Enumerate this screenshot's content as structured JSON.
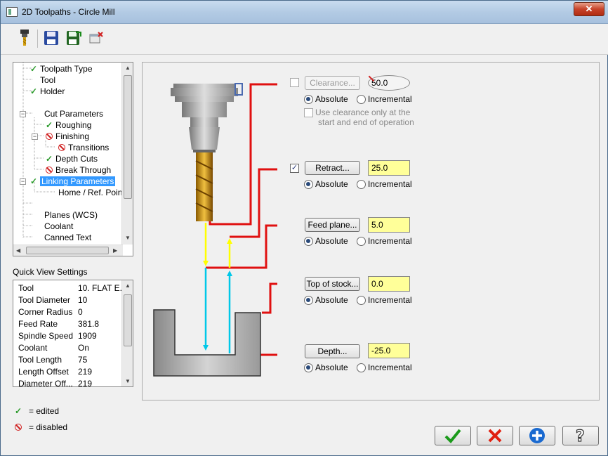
{
  "window": {
    "title": "2D Toolpaths - Circle Mill",
    "close_label": "✕"
  },
  "tree": {
    "items": [
      {
        "label": "Toolpath Type",
        "status": "edited"
      },
      {
        "label": "Tool",
        "status": ""
      },
      {
        "label": "Holder",
        "status": "edited"
      },
      {
        "label": "Cut Parameters",
        "status": ""
      },
      {
        "label": "Roughing",
        "status": "edited"
      },
      {
        "label": "Finishing",
        "status": "disabled"
      },
      {
        "label": "Transitions",
        "status": "disabled"
      },
      {
        "label": "Depth Cuts",
        "status": "edited"
      },
      {
        "label": "Break Through",
        "status": "disabled"
      },
      {
        "label": "Linking Parameters",
        "status": "edited"
      },
      {
        "label": "Home / Ref. Points",
        "status": ""
      },
      {
        "label": "Planes (WCS)",
        "status": ""
      },
      {
        "label": "Coolant",
        "status": ""
      },
      {
        "label": "Canned Text",
        "status": ""
      }
    ]
  },
  "quick_view": {
    "title": "Quick View Settings",
    "rows": [
      {
        "k": "Tool",
        "v": "10. FLAT E..."
      },
      {
        "k": "Tool Diameter",
        "v": "10"
      },
      {
        "k": "Corner Radius",
        "v": "0"
      },
      {
        "k": "Feed Rate",
        "v": "381.8"
      },
      {
        "k": "Spindle Speed",
        "v": "1909"
      },
      {
        "k": "Coolant",
        "v": "On"
      },
      {
        "k": "Tool Length",
        "v": "75"
      },
      {
        "k": "Length Offset",
        "v": "219"
      },
      {
        "k": "Diameter Off...",
        "v": "219"
      }
    ]
  },
  "legend": {
    "edited": "= edited",
    "disabled": "= disabled"
  },
  "params": {
    "clearance": {
      "label": "Clearance...",
      "value": "50.0",
      "absolute": "Absolute",
      "incremental": "Incremental",
      "note_line1": "Use clearance only at the",
      "note_line2": "start and end of operation"
    },
    "retract": {
      "label": "Retract...",
      "value": "25.0",
      "absolute": "Absolute",
      "incremental": "Incremental"
    },
    "feed_plane": {
      "label": "Feed plane...",
      "value": "5.0",
      "absolute": "Absolute",
      "incremental": "Incremental"
    },
    "top_of_stock": {
      "label": "Top of stock...",
      "value": "0.0",
      "absolute": "Absolute",
      "incremental": "Incremental"
    },
    "depth": {
      "label": "Depth...",
      "value": "-25.0",
      "absolute": "Absolute",
      "incremental": "Incremental"
    }
  },
  "colors": {
    "accent_red": "#e01010",
    "arrow_yellow": "#ffff00",
    "arrow_cyan": "#00c8e8",
    "field_yellow": "#ffff99",
    "selection_blue": "#3399ff"
  },
  "icons": [
    "tool-holder-icon",
    "save-icon",
    "save-as-icon",
    "delete-icon",
    "ok-icon",
    "cancel-icon",
    "add-icon",
    "help-icon"
  ]
}
